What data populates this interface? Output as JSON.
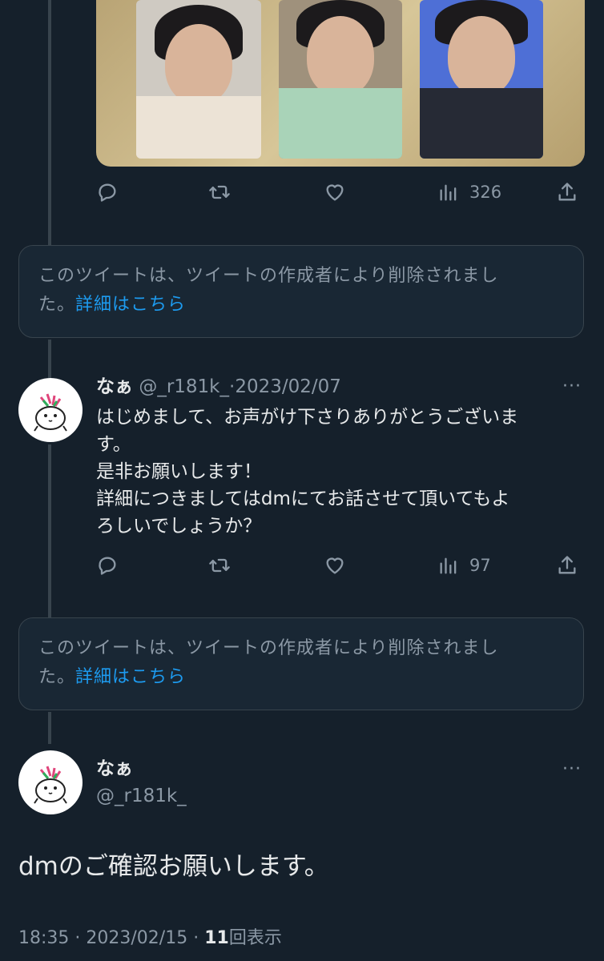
{
  "first_tweet": {
    "views": "326"
  },
  "deleted_notice_1": {
    "line1": "このツイートは、ツイートの作成者により削除されまし",
    "line2_prefix": "た。",
    "link": "詳細はこちら"
  },
  "reply_tweet": {
    "name": "なぁ",
    "handle": "@_r181k_",
    "separator": "·",
    "date": "2023/02/07",
    "more": "···",
    "text_lines": [
      "はじめまして、お声がけ下さりありがとうございま",
      "す。",
      "是非お願いします！",
      "詳細につきましてはdmにてお話させて頂いてもよ",
      "ろしいでしょうか？"
    ],
    "views": "97"
  },
  "deleted_notice_2": {
    "line1": "このツイートは、ツイートの作成者により削除されまし",
    "line2_prefix": "た。",
    "link": "詳細はこちら"
  },
  "main_tweet": {
    "name": "なぁ",
    "handle": "@_r181k_",
    "more": "···",
    "text": "dmのご確認お願いします。",
    "time": "18:35",
    "sep1": "·",
    "date": "2023/02/15",
    "sep2": "·",
    "views_count": "11",
    "views_label": "回表示"
  },
  "icons": [
    "reply-icon",
    "retweet-icon",
    "like-icon",
    "views-icon",
    "share-icon",
    "more-icon"
  ],
  "colors": {
    "background": "#15202b",
    "accent": "#1d9bf0",
    "muted": "#8b98a5",
    "border": "#38444d"
  }
}
